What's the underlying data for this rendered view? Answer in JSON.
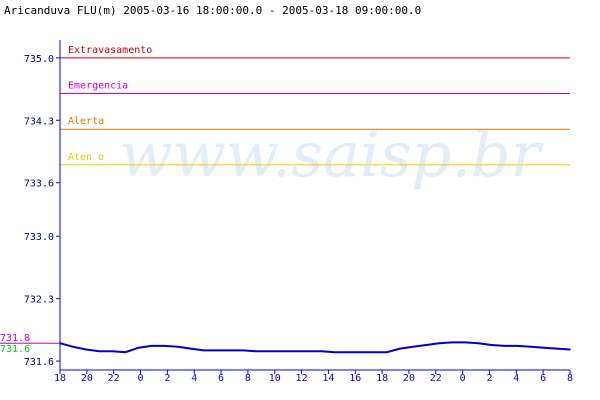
{
  "title": "Aricanduva FLU(m) 2005-03-16 18:00:00.0 - 2005-03-18 09:00:00.0",
  "watermark": "www.saisp.br",
  "colors": {
    "background": "#ffffff",
    "axis": "#0000ff",
    "series": "#0000cc",
    "title": "#000000",
    "watermark": "#e3ecf8"
  },
  "chart_data": {
    "type": "line",
    "title": "Aricanduva FLU(m) 2005-03-16 18:00:00.0 - 2005-03-18 09:00:00.0",
    "xlabel": "",
    "ylabel": "",
    "ylim": [
      731.5,
      735.2
    ],
    "y_ticks": [
      "735.0",
      "734.3",
      "733.6",
      "733.0",
      "732.3",
      "731.6"
    ],
    "y_tick_values": [
      735.0,
      734.3,
      733.6,
      733.0,
      732.3,
      731.6
    ],
    "x_ticks": [
      "18",
      "20",
      "22",
      "0",
      "2",
      "4",
      "6",
      "8",
      "10",
      "12",
      "14",
      "16",
      "18",
      "20",
      "22",
      "0",
      "2",
      "4",
      "6",
      "8"
    ],
    "x_range_hours": [
      0,
      39
    ],
    "grid": false,
    "thresholds": [
      {
        "label": "Extravasamento",
        "value": 735.0,
        "color": "#cc0000"
      },
      {
        "label": "Emergencia",
        "value": 734.6,
        "color": "#cc00cc"
      },
      {
        "label": "Alerta",
        "value": 734.2,
        "color": "#e07800"
      },
      {
        "label": "Aten  o",
        "value": 733.8,
        "color": "#e0d000"
      }
    ],
    "markers": [
      {
        "label": "731.8",
        "value": 731.8,
        "color": "#cc00cc"
      },
      {
        "label": "731.6",
        "value": 731.68,
        "color": "#00cc00"
      }
    ],
    "series": [
      {
        "x": [
          0,
          1,
          2,
          3,
          4,
          5,
          6,
          7,
          8,
          9,
          10,
          11,
          12,
          13,
          14,
          15,
          16,
          17,
          18,
          19,
          20,
          21,
          22,
          23,
          24,
          25,
          26,
          27,
          28,
          29,
          30,
          31,
          32,
          33,
          34,
          35,
          36,
          37,
          38,
          39
        ],
        "y": [
          731.8,
          731.76,
          731.73,
          731.71,
          731.71,
          731.7,
          731.75,
          731.77,
          731.77,
          731.76,
          731.74,
          731.72,
          731.72,
          731.72,
          731.72,
          731.71,
          731.71,
          731.71,
          731.71,
          731.71,
          731.71,
          731.7,
          731.7,
          731.7,
          731.7,
          731.7,
          731.74,
          731.76,
          731.78,
          731.8,
          731.81,
          731.81,
          731.8,
          731.78,
          731.77,
          731.77,
          731.76,
          731.75,
          731.74,
          731.73
        ]
      }
    ]
  }
}
